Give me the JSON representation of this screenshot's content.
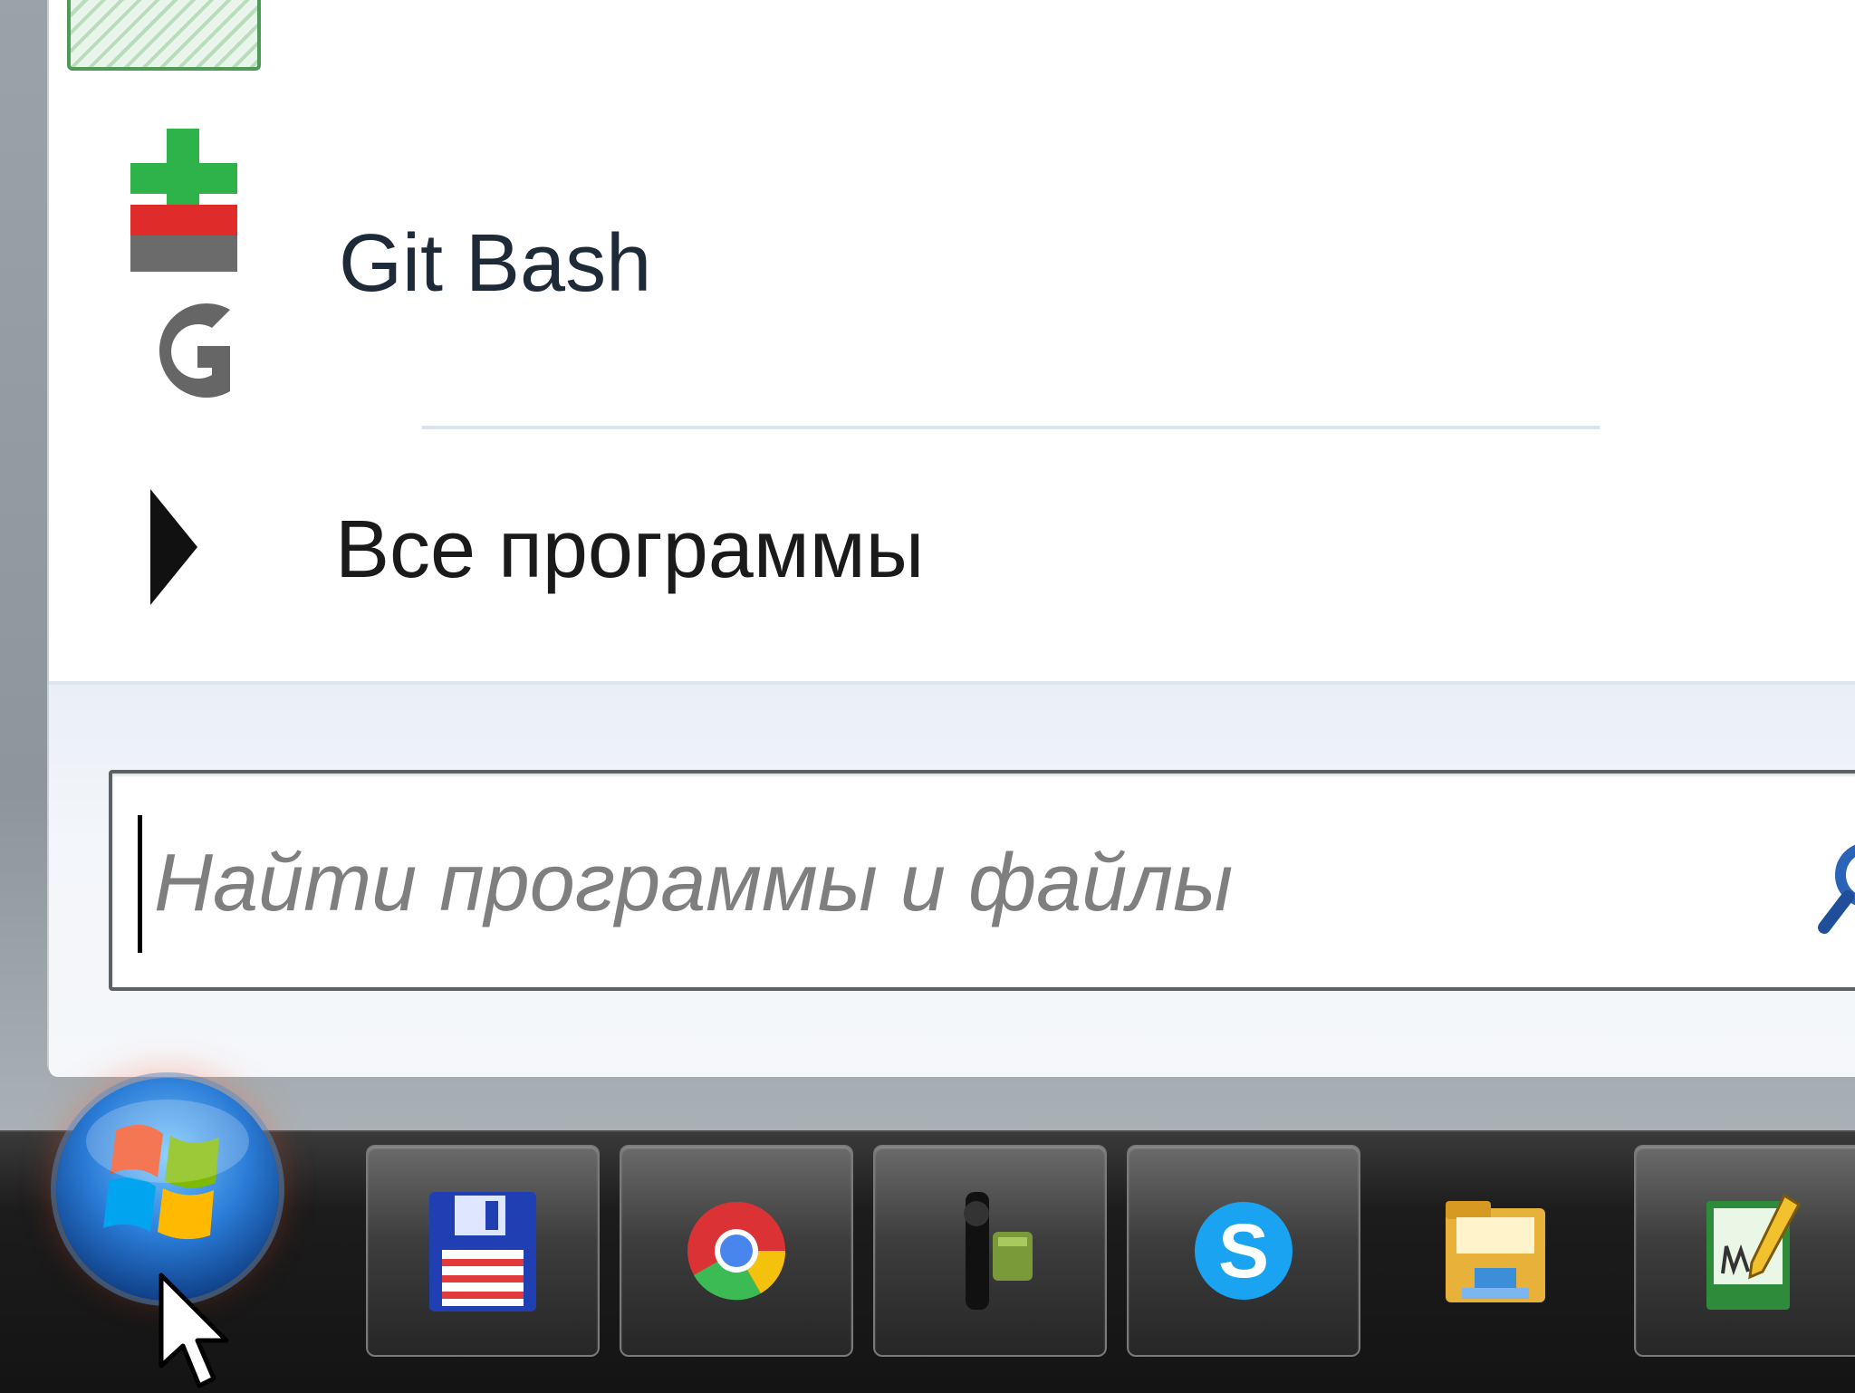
{
  "start_menu": {
    "programs": [
      {
        "label": "Git Bash",
        "icon": "git-bash-icon"
      }
    ],
    "all_programs_label": "Все программы",
    "search": {
      "placeholder": "Найти программы и файлы",
      "value": ""
    }
  },
  "taskbar": {
    "start_button": "windows-start-orb",
    "pinned": [
      {
        "name": "save-app",
        "icon": "floppy-disk-icon",
        "active": true
      },
      {
        "name": "chrome",
        "icon": "chrome-icon",
        "active": true
      },
      {
        "name": "android-tool",
        "icon": "android-tool-icon",
        "active": true
      },
      {
        "name": "skype",
        "icon": "skype-icon",
        "active": true
      },
      {
        "name": "explorer",
        "icon": "folder-icon",
        "active": false
      },
      {
        "name": "editor",
        "icon": "notepad-pen-icon",
        "active": true
      }
    ]
  },
  "colors": {
    "menu_background": "#ffffff",
    "search_area": "#eef2f7",
    "taskbar": "#1a1a1a",
    "accent_blue": "#2a7bd6"
  }
}
